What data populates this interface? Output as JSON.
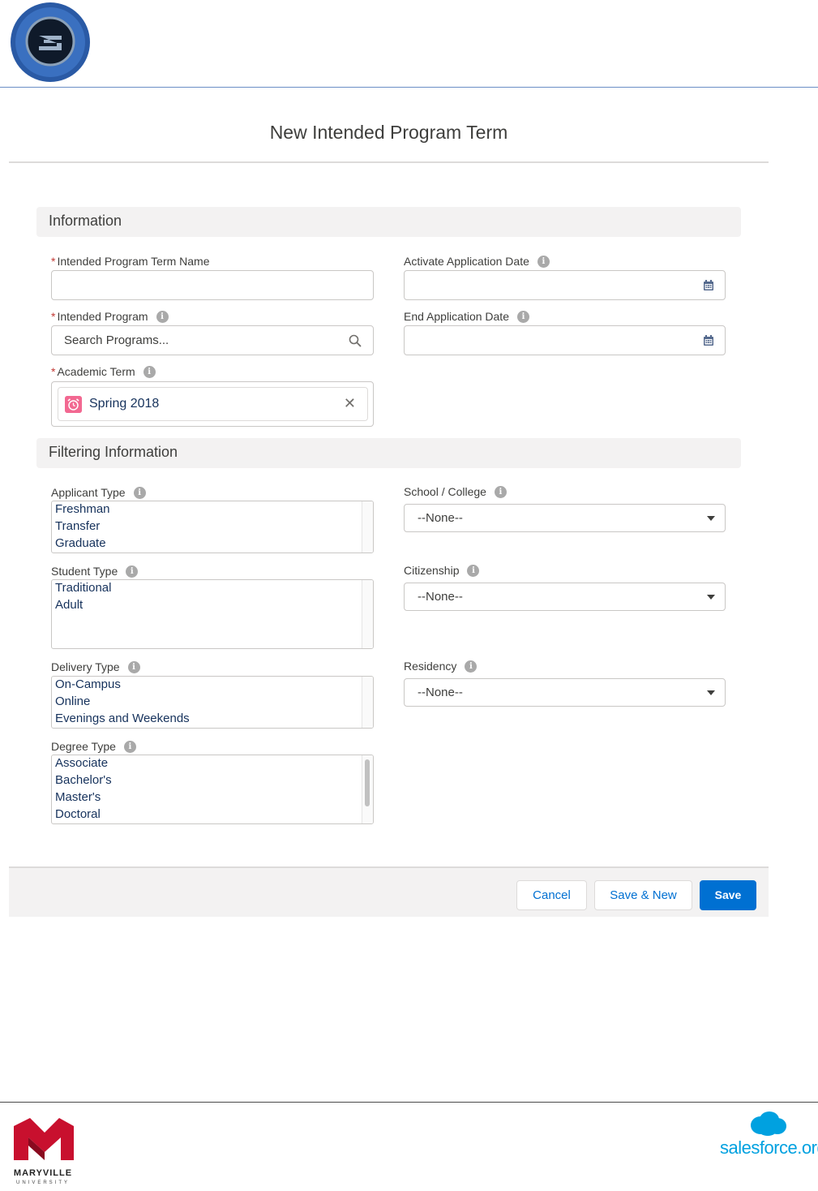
{
  "modal": {
    "title": "New Intended Program Term"
  },
  "sections": {
    "information": "Information",
    "filtering": "Filtering Information"
  },
  "fields": {
    "program_term_name": {
      "label": "Intended Program Term Name",
      "value": ""
    },
    "activate_app_date": {
      "label": "Activate Application Date",
      "value": ""
    },
    "intended_program": {
      "label": "Intended Program",
      "placeholder": "Search Programs..."
    },
    "end_app_date": {
      "label": "End Application Date",
      "value": ""
    },
    "academic_term": {
      "label": "Academic Term",
      "selected": "Spring 2018"
    },
    "applicant_type": {
      "label": "Applicant Type",
      "options": [
        "Freshman",
        "Transfer",
        "Graduate"
      ]
    },
    "school_college": {
      "label": "School / College",
      "value": "--None--"
    },
    "student_type": {
      "label": "Student Type",
      "options": [
        "Traditional",
        "Adult"
      ]
    },
    "citizenship": {
      "label": "Citizenship",
      "value": "--None--"
    },
    "delivery_type": {
      "label": "Delivery Type",
      "options": [
        "On-Campus",
        "Online",
        "Evenings and Weekends"
      ]
    },
    "residency": {
      "label": "Residency",
      "value": "--None--"
    },
    "degree_type": {
      "label": "Degree Type",
      "options": [
        "Associate",
        "Bachelor's",
        "Master's",
        "Doctoral"
      ]
    }
  },
  "required_marker": "*",
  "info_glyph": "i",
  "buttons": {
    "cancel": "Cancel",
    "save_new": "Save & New",
    "save": "Save"
  },
  "footer": {
    "university_name": "MARYVILLE",
    "university_sub": "UNIVERSITY",
    "partner_brand": "salesforce.org"
  },
  "colors": {
    "brand_blue": "#0070d2",
    "required_red": "#c23934",
    "section_bg": "#f3f2f2",
    "pill_icon": "#f26891",
    "salesforce_blue": "#00a1e0",
    "maryville_red": "#c8102e"
  }
}
